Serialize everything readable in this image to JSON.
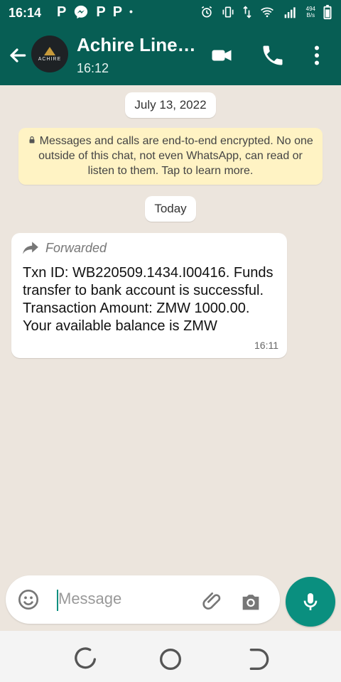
{
  "status_bar": {
    "time": "16:14",
    "left_icons": [
      "P",
      "messenger-icon",
      "P",
      "P",
      "dot"
    ],
    "right_icons": [
      "alarm-icon",
      "vibrate-icon",
      "data-arrows-icon",
      "wifi-icon",
      "signal-icon",
      "battery-icon"
    ],
    "net_speed_value": "494",
    "net_speed_unit": "B/s"
  },
  "header": {
    "contact_name": "Achire Line…",
    "last_seen": "16:12",
    "avatar_text": "ACHIRE",
    "icons": [
      "back-arrow-icon",
      "video-call-icon",
      "voice-call-icon",
      "more-vert-icon"
    ]
  },
  "chat": {
    "date_label": "July 13, 2022",
    "encryption_notice": "Messages and calls are end-to-end encrypted. No one outside of this chat, not even WhatsApp, can read or listen to them. Tap to learn more.",
    "today_label": "Today",
    "message": {
      "forwarded_label": "Forwarded",
      "text": "Txn ID: WB220509.1434.I00416. Funds transfer to bank account is successful. Transaction Amount: ZMW 1000.00. Your available balance is ZMW",
      "time": "16:11"
    }
  },
  "composer": {
    "placeholder": "Message",
    "icons": [
      "emoji-icon",
      "attach-icon",
      "camera-icon",
      "mic-icon"
    ]
  },
  "colors": {
    "header_bg": "#075e54",
    "accent": "#0a8f7f",
    "chat_bg": "#ece5dd",
    "encryption_bg": "#fff3c4"
  }
}
